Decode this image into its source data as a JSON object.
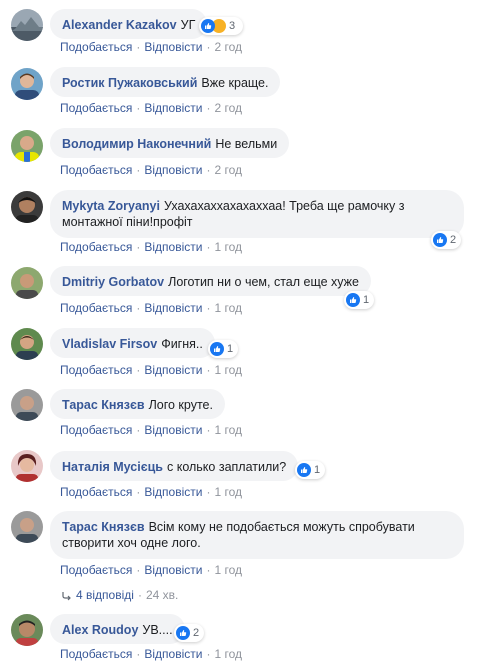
{
  "actions": {
    "like": "Подобається",
    "reply": "Відповісти",
    "sep": "·"
  },
  "comments": [
    {
      "author": "Alexander Kazakov",
      "text": "УГ",
      "time": "2 год",
      "reactions": "3"
    },
    {
      "author": "Ростик Пужаковський",
      "text": "Вже краще.",
      "time": "2 год",
      "reactions": ""
    },
    {
      "author": "Володимир Наконечний",
      "text": "Не вельми",
      "time": "2 год",
      "reactions": ""
    },
    {
      "author": "Mykyta Zoryanyi",
      "text": "Ухахахаххахахаххаа! Треба ще рамочку з монтажної піни!профіт",
      "time": "1 год",
      "reactions": "2"
    },
    {
      "author": "Dmitriy Gorbatov",
      "text": "Логотип ни о чем, стал еще хуже",
      "time": "1 год",
      "reactions": "1"
    },
    {
      "author": "Vladislav Firsov",
      "text": "Фигня..",
      "time": "1 год",
      "reactions": "1"
    },
    {
      "author": "Тарас Князєв",
      "text": "Лого круте.",
      "time": "1 год",
      "reactions": ""
    },
    {
      "author": "Наталія Мусієць",
      "text": "с колько заплатили?",
      "time": "1 год",
      "reactions": "1"
    },
    {
      "author": "Тарас Князєв",
      "text": "Всім кому не подобається можуть спробувати створити хоч одне лого.",
      "time": "1 год",
      "reactions": ""
    },
    {
      "author": "Alex Roudoy",
      "text": "УВ....",
      "time": "1 год",
      "reactions": "2"
    }
  ],
  "replies": {
    "label": "4 відповіді",
    "time": "24 хв."
  }
}
